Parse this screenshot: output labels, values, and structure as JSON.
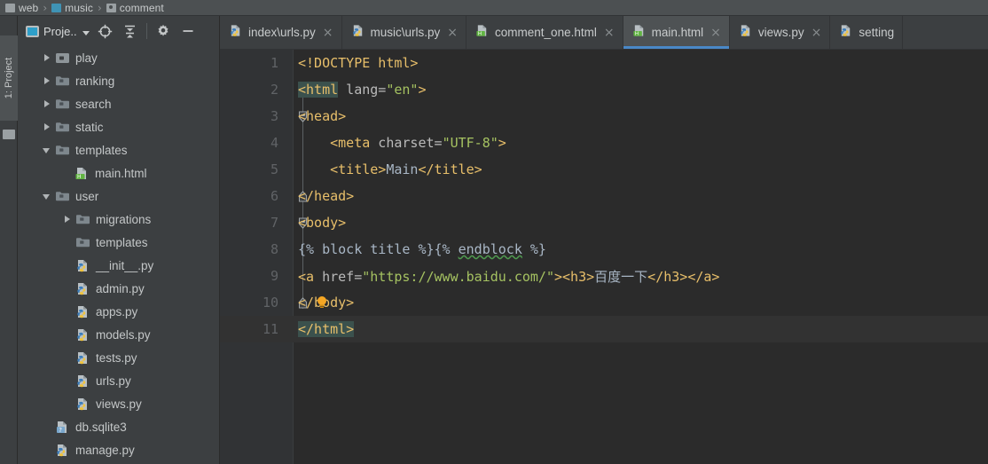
{
  "breadcrumb": {
    "items": [
      {
        "label": "web",
        "icon": "folder-grey-icon"
      },
      {
        "label": "music",
        "icon": "folder-blue-icon"
      },
      {
        "label": "comment",
        "icon": "module-icon"
      }
    ],
    "separator": "›"
  },
  "left_strip": {
    "project_tool_window": "1: Project"
  },
  "project_panel": {
    "toolbar": {
      "title": "Proje..",
      "buttons": [
        {
          "name": "locate-icon",
          "tooltip": "Select Opened File"
        },
        {
          "name": "collapse-all-icon",
          "tooltip": "Collapse All"
        },
        {
          "name": "gear-icon",
          "tooltip": "Settings"
        },
        {
          "name": "minimize-icon",
          "tooltip": "Hide"
        }
      ]
    },
    "tree": [
      {
        "label": "play",
        "indent": 1,
        "arrow": "right",
        "icon": "module-icon"
      },
      {
        "label": "ranking",
        "indent": 1,
        "arrow": "right",
        "icon": "folder-icon"
      },
      {
        "label": "search",
        "indent": 1,
        "arrow": "right",
        "icon": "folder-icon"
      },
      {
        "label": "static",
        "indent": 1,
        "arrow": "right",
        "icon": "folder-icon"
      },
      {
        "label": "templates",
        "indent": 1,
        "arrow": "down",
        "icon": "folder-icon"
      },
      {
        "label": "main.html",
        "indent": 2,
        "arrow": "none",
        "icon": "html-file-icon"
      },
      {
        "label": "user",
        "indent": 1,
        "arrow": "down",
        "icon": "folder-icon"
      },
      {
        "label": "migrations",
        "indent": 2,
        "arrow": "right",
        "icon": "folder-icon"
      },
      {
        "label": "templates",
        "indent": 2,
        "arrow": "none",
        "icon": "folder-icon"
      },
      {
        "label": "__init__.py",
        "indent": 3,
        "arrow": "none",
        "icon": "python-file-icon"
      },
      {
        "label": "admin.py",
        "indent": 3,
        "arrow": "none",
        "icon": "python-file-icon"
      },
      {
        "label": "apps.py",
        "indent": 3,
        "arrow": "none",
        "icon": "python-file-icon"
      },
      {
        "label": "models.py",
        "indent": 3,
        "arrow": "none",
        "icon": "python-file-icon"
      },
      {
        "label": "tests.py",
        "indent": 3,
        "arrow": "none",
        "icon": "python-file-icon"
      },
      {
        "label": "urls.py",
        "indent": 3,
        "arrow": "none",
        "icon": "python-file-icon"
      },
      {
        "label": "views.py",
        "indent": 3,
        "arrow": "none",
        "icon": "python-file-icon"
      },
      {
        "label": "db.sqlite3",
        "indent": 2,
        "arrow": "none",
        "icon": "unknown-file-icon"
      },
      {
        "label": "manage.py",
        "indent": 2,
        "arrow": "none",
        "icon": "python-file-icon"
      }
    ]
  },
  "editor": {
    "tabs": [
      {
        "label": "index\\urls.py",
        "icon": "python-file-icon",
        "active": false,
        "closable": true
      },
      {
        "label": "music\\urls.py",
        "icon": "python-file-icon",
        "active": false,
        "closable": true
      },
      {
        "label": "comment_one.html",
        "icon": "html-file-icon",
        "active": false,
        "closable": true
      },
      {
        "label": "main.html",
        "icon": "html-file-icon",
        "active": true,
        "closable": true
      },
      {
        "label": "views.py",
        "icon": "python-file-icon",
        "active": false,
        "closable": true
      },
      {
        "label": "setting",
        "icon": "python-file-icon",
        "active": false,
        "closable": false
      }
    ],
    "close_glyph": "×",
    "lines": [
      {
        "num": "1",
        "text": "<!DOCTYPE html>"
      },
      {
        "num": "2",
        "text": "<html lang=\"en\">"
      },
      {
        "num": "3",
        "text": "<head>"
      },
      {
        "num": "4",
        "text": "    <meta charset=\"UTF-8\">"
      },
      {
        "num": "5",
        "text": "    <title>Main</title>"
      },
      {
        "num": "6",
        "text": "</head>"
      },
      {
        "num": "7",
        "text": "<body>"
      },
      {
        "num": "8",
        "text": "{% block title %}{% endblock %}"
      },
      {
        "num": "9",
        "text": "<a href=\"https://www.baidu.com/\"><h3>百度一下</h3></a>"
      },
      {
        "num": "10",
        "text": "</body>"
      },
      {
        "num": "11",
        "text": "</html>"
      }
    ],
    "current_line": "11"
  },
  "colors": {
    "editor_bg": "#2b2b2b",
    "panel_bg": "#3c3f41",
    "gutter_bg": "#313335",
    "active_tab_bg": "#4e5254",
    "tab_underline": "#4a88c7",
    "tag": "#e8bf6a",
    "string": "#a5c261",
    "template": "#bbb529",
    "text": "#a9b7c6",
    "brace_highlight": "#3b514d",
    "error_squiggle": "#4f9b4f"
  }
}
